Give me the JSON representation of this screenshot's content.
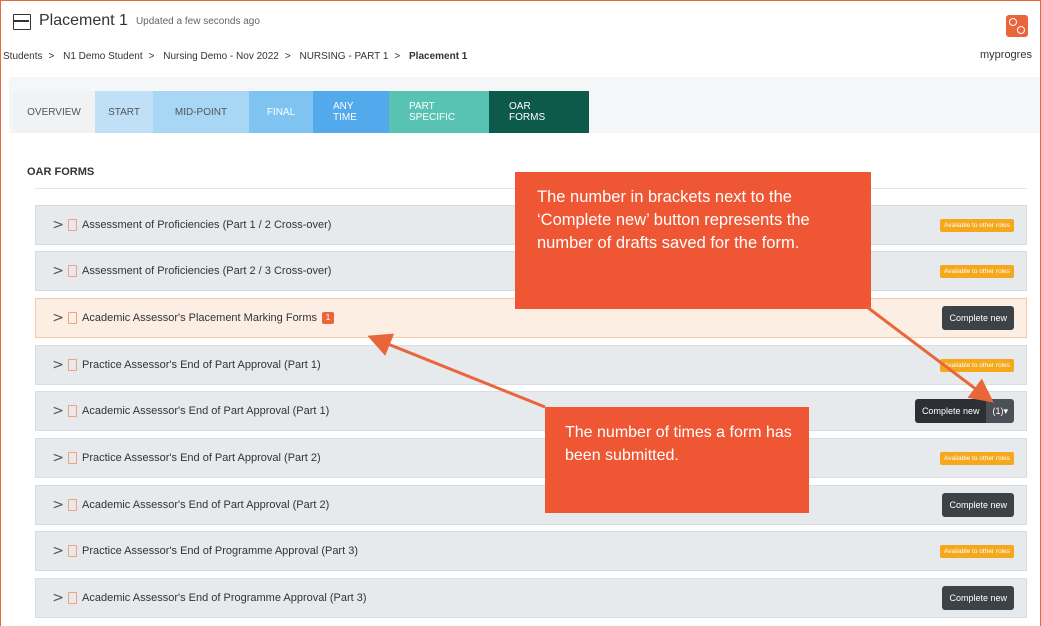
{
  "header": {
    "title": "Placement 1",
    "updated": "Updated a few seconds ago",
    "logo_text": "myprogres"
  },
  "breadcrumb": [
    "Students",
    "N1 Demo Student",
    "Nursing Demo - Nov 2022",
    "NURSING - PART 1",
    "Placement 1"
  ],
  "tabs": [
    {
      "label": "OVERVIEW"
    },
    {
      "label": "START"
    },
    {
      "label": "MID-POINT"
    },
    {
      "label": "FINAL"
    },
    {
      "label": "ANY TIME"
    },
    {
      "label": "PART SPECIFIC"
    },
    {
      "label": "OAR FORMS"
    }
  ],
  "section_title": "OAR FORMS",
  "forms": [
    {
      "label": "Assessment of Proficiencies (Part 1 / 2 Cross-over)",
      "action": "Available to other roles"
    },
    {
      "label": "Assessment of Proficiencies (Part 2 / 3 Cross-over)",
      "action": "Available to other roles"
    },
    {
      "label": "Academic Assessor's Placement Marking Forms",
      "count": "1",
      "action": "Complete new"
    },
    {
      "label": "Practice Assessor's End of Part Approval (Part 1)",
      "action": "Available to other roles"
    },
    {
      "label": "Academic Assessor's End of Part Approval (Part 1)",
      "action": "Complete new",
      "drafts": "(1)▾"
    },
    {
      "label": "Practice Assessor's End of Part Approval (Part 2)",
      "action": "Available to other roles"
    },
    {
      "label": "Academic Assessor's End of Part Approval (Part 2)",
      "action": "Complete new"
    },
    {
      "label": "Practice Assessor's End of Programme Approval (Part 3)",
      "action": "Available to other roles"
    },
    {
      "label": "Academic Assessor's End of Programme Approval (Part 3)",
      "action": "Complete new"
    }
  ],
  "callouts": {
    "drafts": "The number in brackets next to the ‘Complete new’ button represents the number of drafts saved for the form.",
    "submitted": "The number of times a form has been submitted."
  },
  "colors": {
    "accent": "#e8663a",
    "callout": "#ef5634",
    "available_badge": "#f5a81c",
    "active_tab": "#0e5a4a"
  }
}
